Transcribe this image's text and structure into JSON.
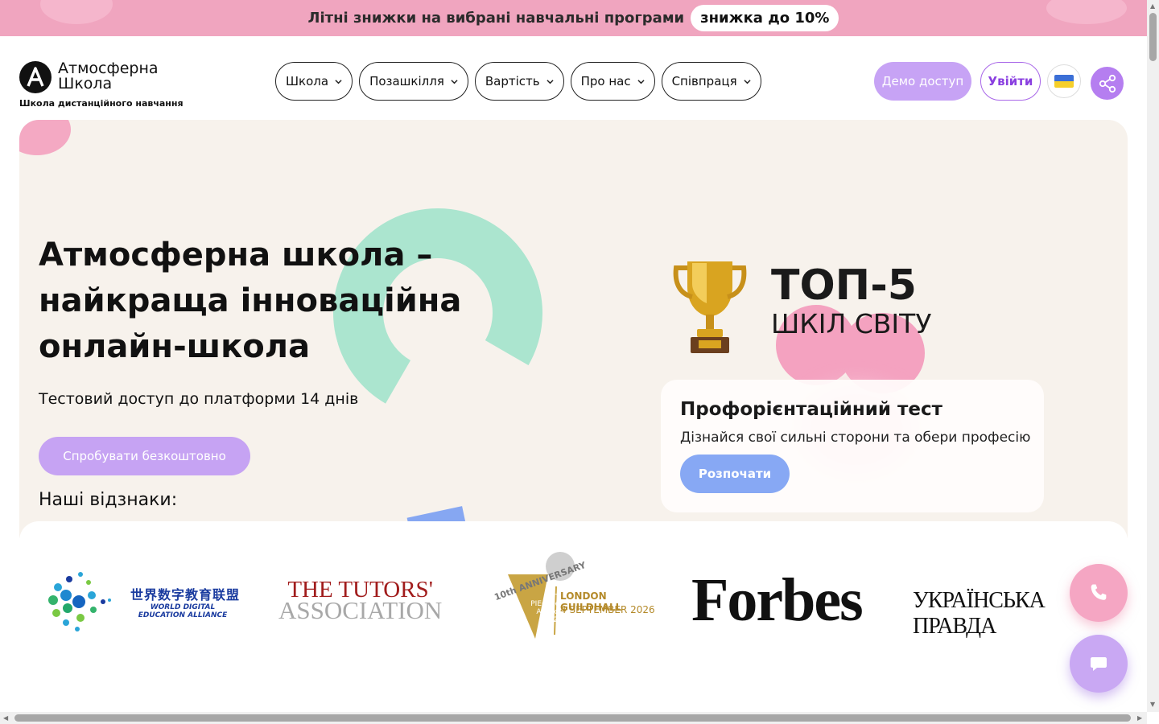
{
  "promo": {
    "text": "Літні знижки на вибрані навчальні програми",
    "pill": "знижка до 10%"
  },
  "header": {
    "logo_name": "Атмосферна Школа",
    "logo_subtitle": "Школа дистанційного навчання",
    "nav": [
      {
        "label": "Школа"
      },
      {
        "label": "Позашкілля"
      },
      {
        "label": "Вартість"
      },
      {
        "label": "Про нас"
      },
      {
        "label": "Співпраця"
      }
    ],
    "demo_label": "Демо доступ",
    "login_label": "Увійти",
    "language_icon": "ukraine-flag-icon",
    "share_icon": "share-icon"
  },
  "hero": {
    "title": "Атмосферна школа – найкраща інноваційна онлайн-школа",
    "subtitle": "Тестовий доступ до платформи 14 днів",
    "cta_label": "Спробувати безкоштовно",
    "awards_heading": "Наші відзнаки:",
    "top_rank": "ТОП-5",
    "top_rank_sub": "ШКІЛ СВІТУ",
    "test_card": {
      "title": "Профорієнтаційний тест",
      "description": "Дізнайся свої сильні сторони та обери професію",
      "button_label": "Розпочати"
    }
  },
  "awards": {
    "wdea_cn": "世界数字教育联盟",
    "wdea_en": "WORLD DIGITAL EDUCATION ALLIANCE",
    "tutors_line1": "THE TUTORS'",
    "tutors_line2": "ASSOCIATION",
    "pie_anniversary": "10th ANNIVERSARY",
    "pie_name": "The PIEoneer Awards 2026",
    "pie_venue": "LONDON GUILDHALL",
    "pie_date": "4 SEPTEMBER 2026",
    "forbes": "Forbes",
    "pravda": "УКРАЇНСЬКА ПРАВДА"
  },
  "colors": {
    "promo_bg": "#f0a5bf",
    "hero_bg": "#f7f2ec",
    "purple": "#c7a3f5",
    "blue": "#87a8f4",
    "pink": "#f5a6c3",
    "mint": "#abe5cf"
  }
}
